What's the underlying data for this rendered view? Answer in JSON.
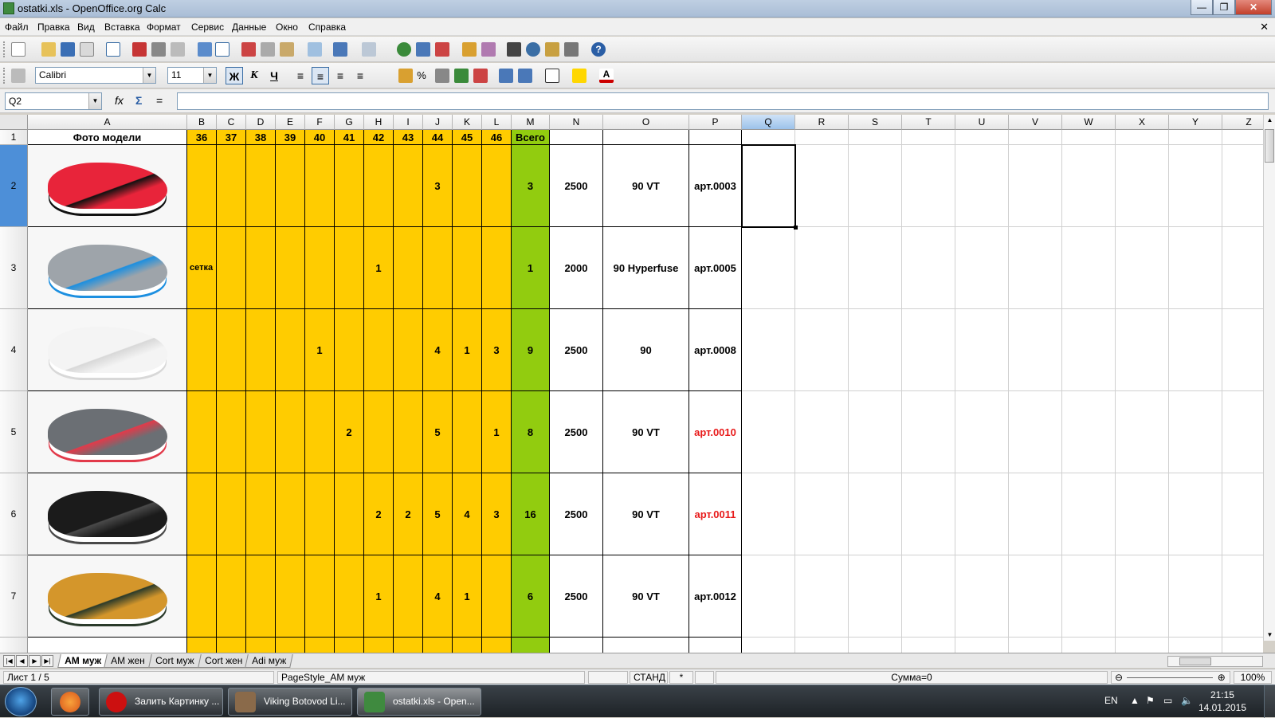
{
  "window": {
    "title": "ostatki.xls - OpenOffice.org Calc"
  },
  "menu": [
    "Файл",
    "Правка",
    "Вид",
    "Вставка",
    "Формат",
    "Сервис",
    "Данные",
    "Окно",
    "Справка"
  ],
  "toolbar": {
    "font_name": "Calibri",
    "font_size": "11",
    "bold": "Ж",
    "italic": "К",
    "underline": "Ч",
    "percent": "%"
  },
  "formula": {
    "cell_ref": "Q2",
    "content": ""
  },
  "columns": [
    "A",
    "B",
    "C",
    "D",
    "E",
    "F",
    "G",
    "H",
    "I",
    "J",
    "K",
    "L",
    "M",
    "N",
    "O",
    "P",
    "Q",
    "R",
    "S",
    "T",
    "U",
    "V",
    "W",
    "X",
    "Y",
    "Z"
  ],
  "header_row": {
    "row": "1",
    "cells": [
      "Фото модели",
      "36",
      "37",
      "38",
      "39",
      "40",
      "41",
      "42",
      "43",
      "44",
      "45",
      "46",
      "Всего",
      "",
      "",
      ""
    ]
  },
  "rows": [
    {
      "row": "2",
      "photo": "red-sneaker",
      "sizes": [
        "",
        "",
        "",
        "",
        "",
        "",
        "",
        "",
        "3",
        "",
        ""
      ],
      "total": "3",
      "price": "2500",
      "model": "90 VT",
      "article": "арт.0003",
      "article_color": "#000000"
    },
    {
      "row": "3",
      "photo": "grey-blue-sneaker",
      "sizes": [
        "сетка",
        "",
        "",
        "",
        "",
        "",
        "1",
        "",
        "",
        "",
        ""
      ],
      "total": "1",
      "price": "2000",
      "model": "90 Hyperfuse",
      "article": "арт.0005",
      "article_color": "#000000"
    },
    {
      "row": "4",
      "photo": "white-sneaker",
      "sizes": [
        "",
        "",
        "",
        "",
        "1",
        "",
        "",
        "",
        "4",
        "1",
        "3"
      ],
      "total": "9",
      "price": "2500",
      "model": "90",
      "article": "арт.0008",
      "article_color": "#000000"
    },
    {
      "row": "5",
      "photo": "grey-sneaker",
      "sizes": [
        "",
        "",
        "",
        "",
        "",
        "2",
        "",
        "",
        "5",
        "",
        "1"
      ],
      "total": "8",
      "price": "2500",
      "model": "90 VT",
      "article": "арт.0010",
      "article_color": "#e81a1a"
    },
    {
      "row": "6",
      "photo": "black-sneaker",
      "sizes": [
        "",
        "",
        "",
        "",
        "",
        "",
        "2",
        "2",
        "5",
        "4",
        "3"
      ],
      "total": "16",
      "price": "2500",
      "model": "90 VT",
      "article": "арт.0011",
      "article_color": "#e81a1a"
    },
    {
      "row": "7",
      "photo": "tan-sneaker",
      "sizes": [
        "",
        "",
        "",
        "",
        "",
        "",
        "1",
        "",
        "4",
        "1",
        ""
      ],
      "total": "6",
      "price": "2500",
      "model": "90 VT",
      "article": "арт.0012",
      "article_color": "#000000"
    }
  ],
  "sheet_tabs": [
    "AM муж",
    "AM жен",
    "Cort муж",
    "Cort жен",
    "Adi муж"
  ],
  "active_tab": "AM муж",
  "status": {
    "sheet": "Лист 1 / 5",
    "page_style": "PageStyle_AM муж",
    "mode": "СТАНД",
    "modified": "*",
    "sum": "Сумма=0",
    "zoom": "100%"
  },
  "taskbar": {
    "apps": [
      {
        "label": "Залить Картинку ...",
        "icon": "opera-icon",
        "color": "#cc1010"
      },
      {
        "label": "Viking Botovod Li...",
        "icon": "viking-icon",
        "color": "#8a6a4a"
      },
      {
        "label": "ostatki.xls - Open...",
        "icon": "calc-icon",
        "color": "#3f8a3f"
      }
    ],
    "lang": "EN",
    "time": "21:15",
    "date": "14.01.2015"
  }
}
